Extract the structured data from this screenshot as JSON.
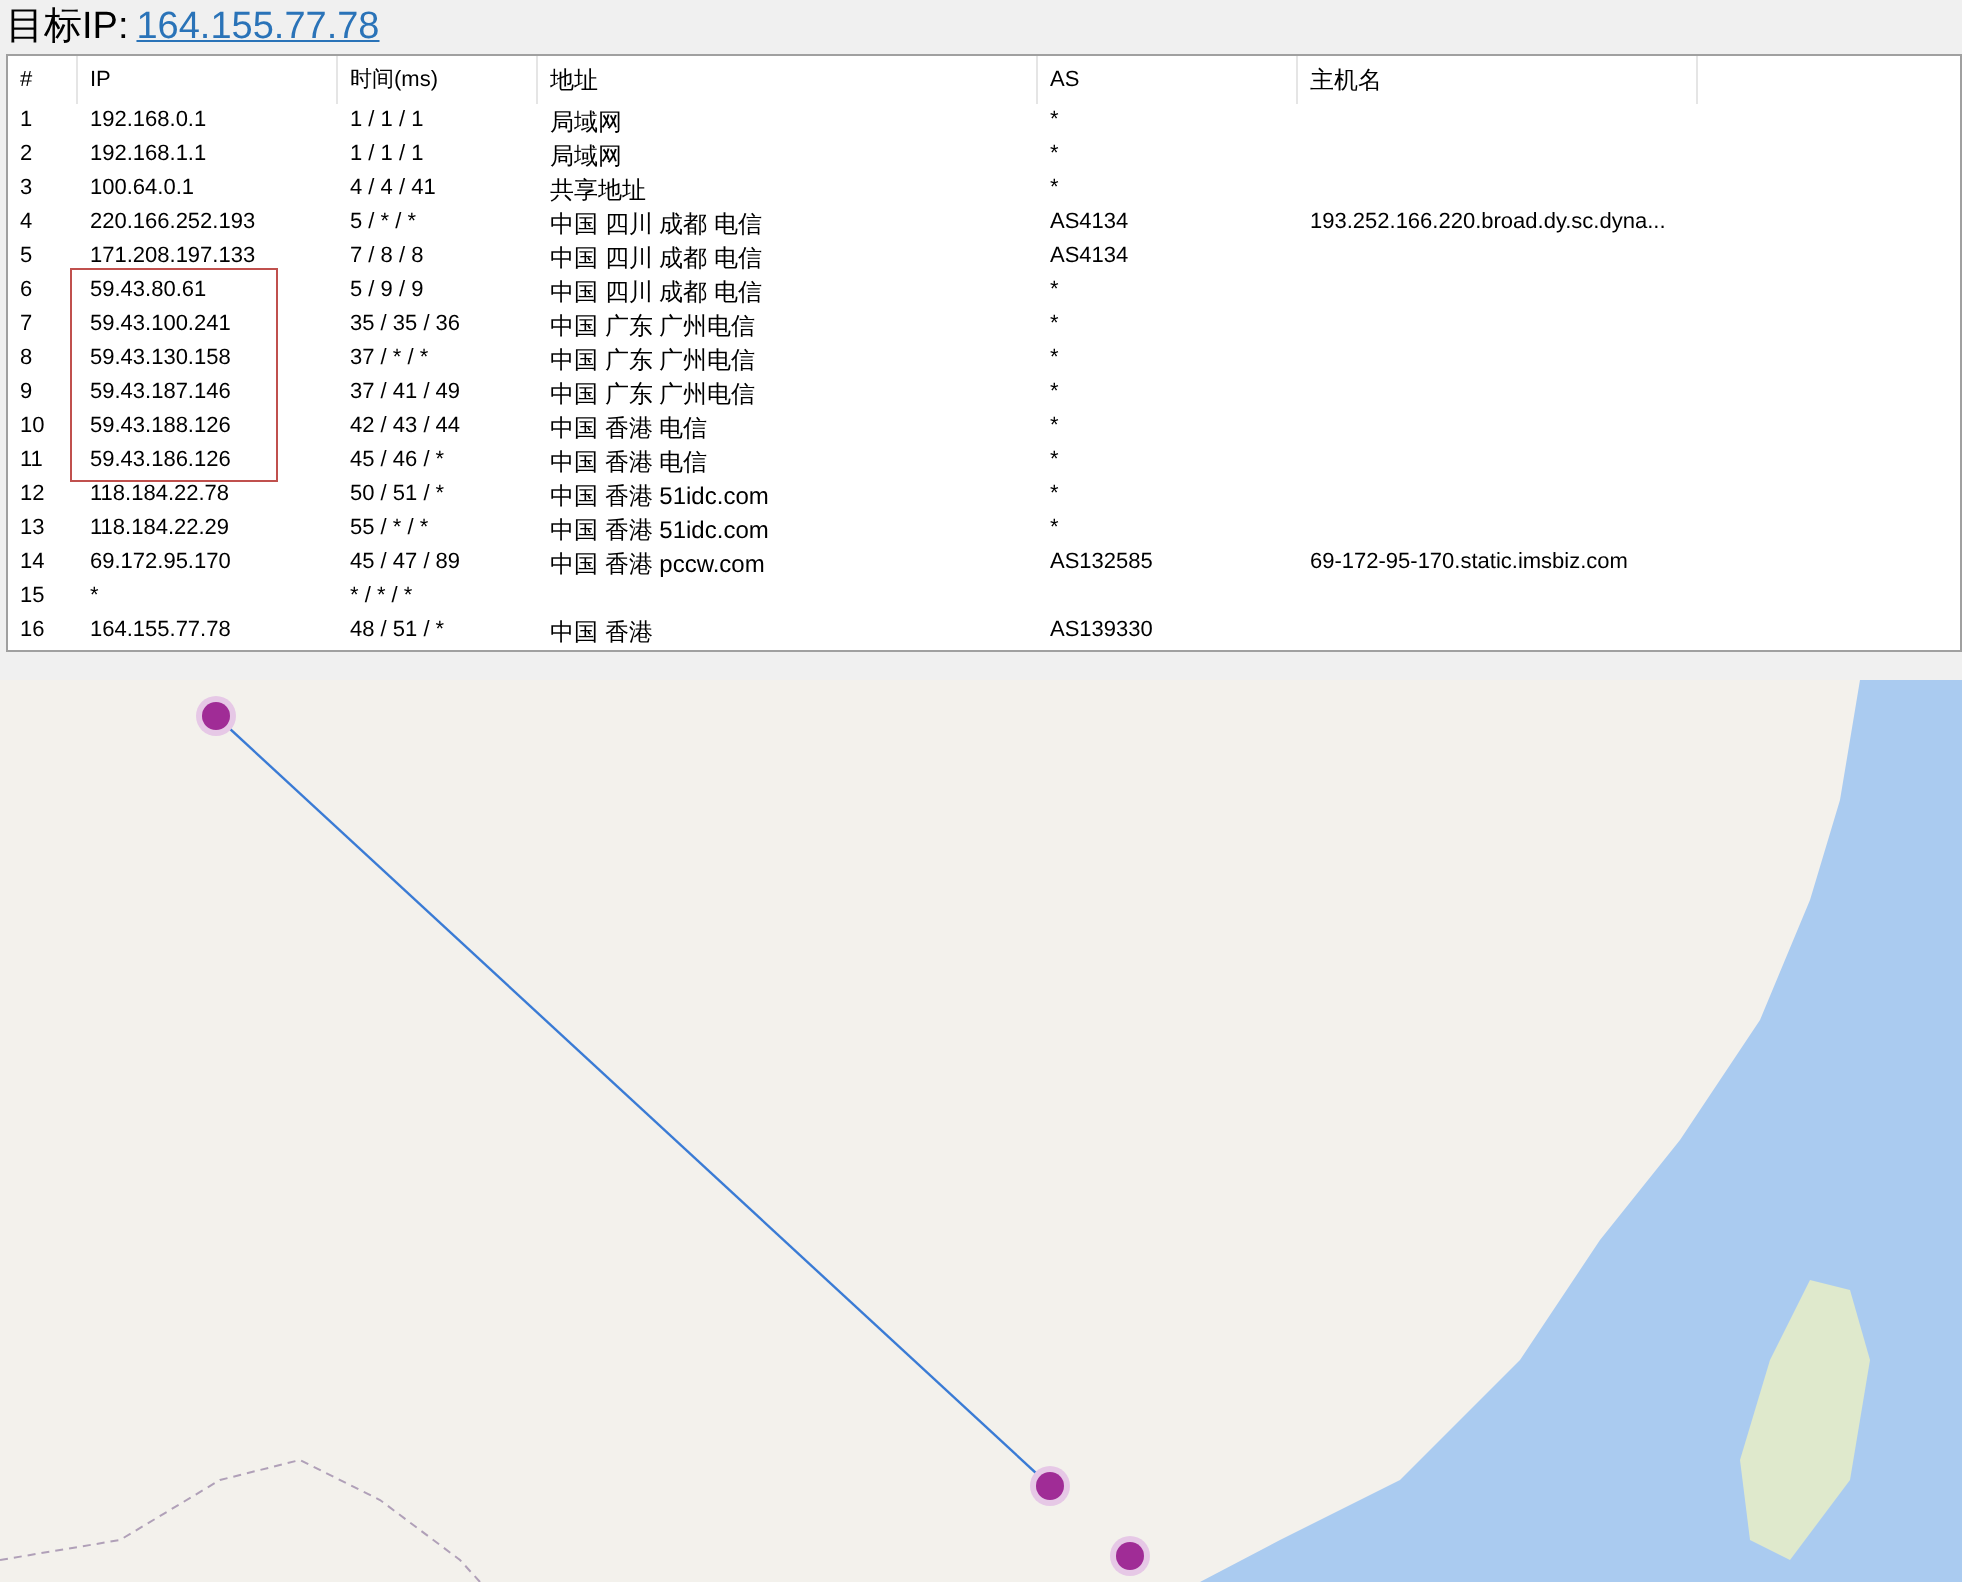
{
  "target": {
    "label": "目标IP:",
    "ip": "164.155.77.78"
  },
  "table": {
    "columns": [
      "#",
      "IP",
      "时间(ms)",
      "地址",
      "AS",
      "主机名"
    ],
    "rows": [
      {
        "cells": [
          "1",
          "192.168.0.1",
          "1 / 1 / 1",
          "局域网",
          "*",
          ""
        ],
        "highlighted": false
      },
      {
        "cells": [
          "2",
          "192.168.1.1",
          "1 / 1 / 1",
          "局域网",
          "*",
          ""
        ],
        "highlighted": false
      },
      {
        "cells": [
          "3",
          "100.64.0.1",
          "4 / 4 / 41",
          "共享地址",
          "*",
          ""
        ],
        "highlighted": false
      },
      {
        "cells": [
          "4",
          "220.166.252.193",
          "5 / * / *",
          "中国 四川 成都 电信",
          "AS4134",
          "193.252.166.220.broad.dy.sc.dyna..."
        ],
        "highlighted": false
      },
      {
        "cells": [
          "5",
          "171.208.197.133",
          "7 / 8 / 8",
          "中国 四川 成都 电信",
          "AS4134",
          ""
        ],
        "highlighted": false
      },
      {
        "cells": [
          "6",
          "59.43.80.61",
          "5 / 9 / 9",
          "中国 四川 成都 电信",
          "*",
          ""
        ],
        "highlighted": true
      },
      {
        "cells": [
          "7",
          "59.43.100.241",
          "35 / 35 / 36",
          "中国 广东 广州电信",
          "*",
          ""
        ],
        "highlighted": true
      },
      {
        "cells": [
          "8",
          "59.43.130.158",
          "37 / * / *",
          "中国 广东 广州电信",
          "*",
          ""
        ],
        "highlighted": true
      },
      {
        "cells": [
          "9",
          "59.43.187.146",
          "37 / 41 / 49",
          "中国 广东 广州电信",
          "*",
          ""
        ],
        "highlighted": true
      },
      {
        "cells": [
          "10",
          "59.43.188.126",
          "42 / 43 / 44",
          "中国 香港 电信",
          "*",
          ""
        ],
        "highlighted": true
      },
      {
        "cells": [
          "11",
          "59.43.186.126",
          "45 / 46 / *",
          "中国 香港 电信",
          "*",
          ""
        ],
        "highlighted": true
      },
      {
        "cells": [
          "12",
          "118.184.22.78",
          "50 / 51 / *",
          "中国 香港 51idc.com",
          "*",
          ""
        ],
        "highlighted": false
      },
      {
        "cells": [
          "13",
          "118.184.22.29",
          "55 / * / *",
          "中国 香港 51idc.com",
          "*",
          ""
        ],
        "highlighted": false
      },
      {
        "cells": [
          "14",
          "69.172.95.170",
          "45 / 47 / 89",
          "中国 香港 pccw.com",
          "AS132585",
          "69-172-95-170.static.imsbiz.com"
        ],
        "highlighted": false
      },
      {
        "cells": [
          "15",
          "*",
          "* / * / *",
          "",
          "",
          ""
        ],
        "highlighted": false
      },
      {
        "cells": [
          "16",
          "164.155.77.78",
          "48 / 51 / *",
          "中国 香港",
          "AS139330",
          ""
        ],
        "highlighted": false
      }
    ]
  }
}
